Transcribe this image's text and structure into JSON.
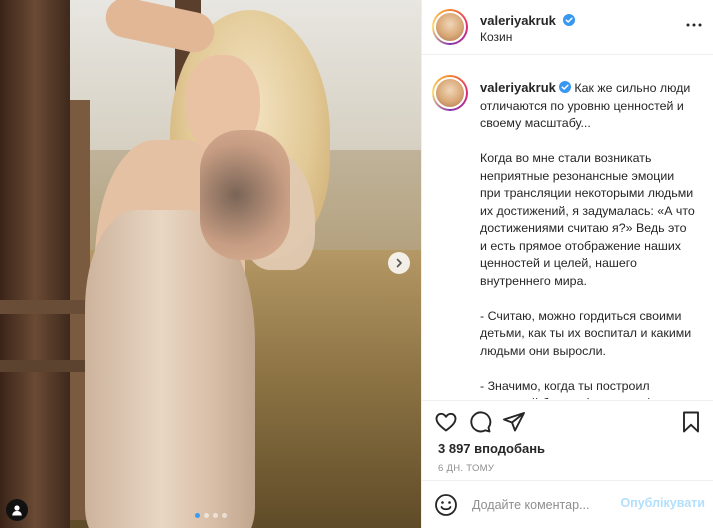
{
  "post": {
    "username": "valeriyakruk",
    "location": "Козин",
    "caption": "Как же сильно люди отличаются по уровню ценностей и своему масштабу...\n\nКогда во мне стали возникать неприятные резонансные эмоции при трансляции некоторыми людьми их достижений, я задумалась: «А что достижениями считаю я?» Ведь это и есть прямое отображение наших ценностей и целей, нашего внутреннего мира.\n\n- Считаю, можно гордиться своими детьми, как ты их воспитал и какими людьми они выросли.\n\n- Значимо, когда ты построил успешный бизнес ( и не один), обеспечил себе и своей семье",
    "likes": "3 897 вподобань",
    "time": "6 ДН. ТОМУ"
  },
  "media": {
    "carousel_count": 4,
    "active_index": 0
  },
  "comment": {
    "placeholder": "Додайте коментар...",
    "publish_label": "Опублікувати"
  },
  "colors": {
    "verified": "#3897f0",
    "publish_disabled": "#b2dffc",
    "muted": "#8e8e8e",
    "active_dot": "#3a9bf0"
  },
  "icons": [
    "verified-icon",
    "more-options-icon",
    "heart-icon",
    "comment-icon",
    "share-icon",
    "bookmark-icon",
    "emoji-icon",
    "chevron-right-icon",
    "user-tag-icon"
  ]
}
